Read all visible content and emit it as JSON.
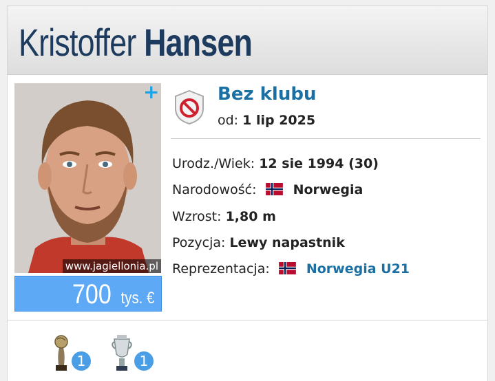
{
  "player": {
    "first_name": "Kristoffer",
    "last_name": "Hansen",
    "photo_credit": "www.jagiellonia.pl",
    "market_value": {
      "amount": "700",
      "unit": "tys. €"
    }
  },
  "club": {
    "name": "Bez klubu",
    "since_label": "od:",
    "since_date": "1 lip 2025"
  },
  "info": {
    "birth_label": "Urodz./Wiek:",
    "birth_value": "12 sie 1994 (30)",
    "nationality_label": "Narodowość:",
    "nationality_value": "Norwegia",
    "height_label": "Wzrost:",
    "height_value": "1,80 m",
    "position_label": "Pozycja:",
    "position_value": "Lewy napastnik",
    "national_team_label": "Reprezentacja:",
    "national_team_value": "Norwegia U21"
  },
  "trophies": [
    {
      "icon": "golden-ball-trophy-icon",
      "count": "1"
    },
    {
      "icon": "cup-trophy-icon",
      "count": "1"
    }
  ],
  "colors": {
    "name": "#1d3a5f",
    "link": "#1a6fa3",
    "value_box": "#5ea9f5",
    "badge": "#4a9ee6",
    "plus": "#1aa3e8"
  }
}
